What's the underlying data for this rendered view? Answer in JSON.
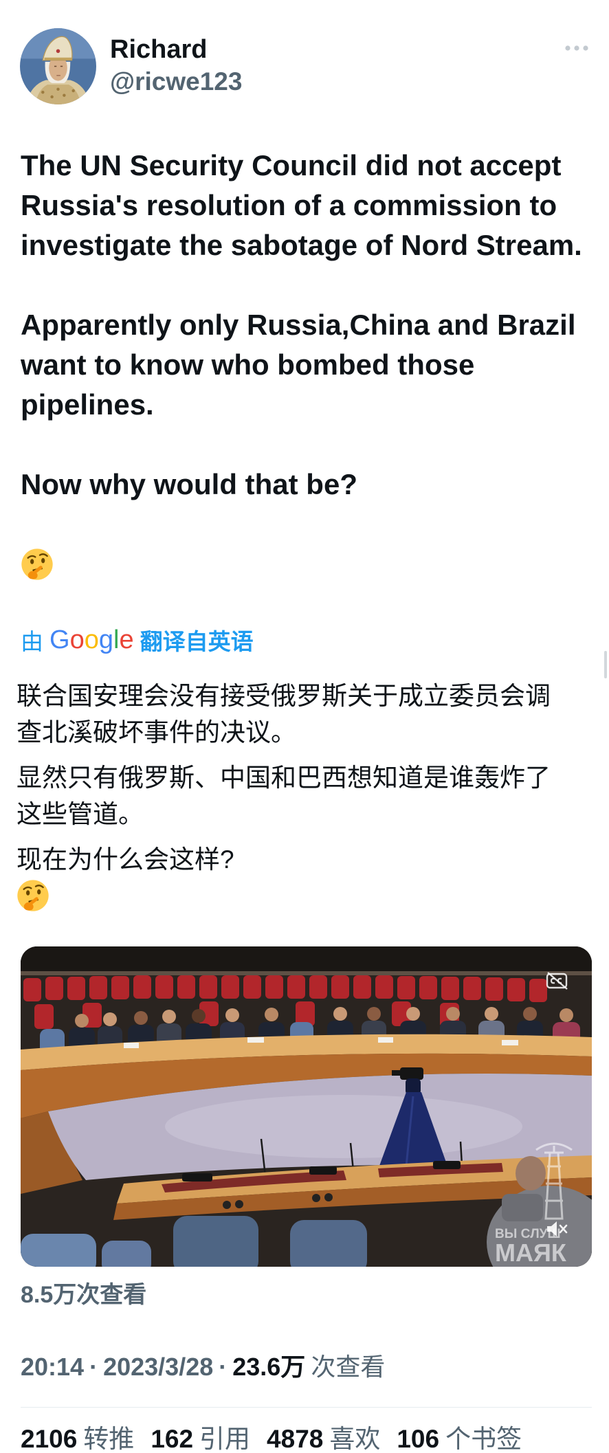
{
  "author": {
    "name": "Richard",
    "handle": "@ricwe123",
    "avatar_icon": "portrait-avatar"
  },
  "header": {
    "more_icon": "more-horizontal-icon"
  },
  "tweet": {
    "text": "The UN Security Council did not accept Russia's resolution of a commission to investigate the sabotage of Nord Stream.\n\nApparently only Russia,China and Brazil want to know who bombed those pipelines.\n\nNow why would that be?",
    "emoji_icon": "thinking-face-icon"
  },
  "translation": {
    "prefix": "由",
    "brand": "Google",
    "suffix": "翻译自英语",
    "brand_colors": [
      "#4285F4",
      "#EA4335",
      "#FBBC05",
      "#4285F4",
      "#34A853",
      "#EA4335"
    ],
    "paragraphs": [
      "联合国安理会没有接受俄罗斯关于成立委员会调查北溪破坏事件的决议。",
      "显然只有俄罗斯、中国和巴西想知道是谁轰炸了这些管道。",
      "现在为什么会这样?"
    ],
    "emoji_icon": "thinking-face-icon"
  },
  "video": {
    "views": "8.5万次查看",
    "captions_icon": "captions-off-icon",
    "mute_icon": "volume-muted-icon",
    "watermark_icon": "lighthouse-icon",
    "watermark_line1": "ВЫ СЛУШ",
    "watermark_line2": "МАЯК"
  },
  "meta": {
    "time": "20:14",
    "separator": "·",
    "date": "2023/3/28",
    "views_count": "23.6万",
    "views_label": "次查看"
  },
  "stats": [
    {
      "count": "2106",
      "label": "转推"
    },
    {
      "count": "162",
      "label": "引用"
    },
    {
      "count": "4878",
      "label": "喜欢"
    },
    {
      "count": "106",
      "label": "个书签"
    }
  ],
  "colors": {
    "text": "#0f1419",
    "secondary": "#536471",
    "link": "#1d9bf0",
    "divider": "#e6ecf0"
  }
}
